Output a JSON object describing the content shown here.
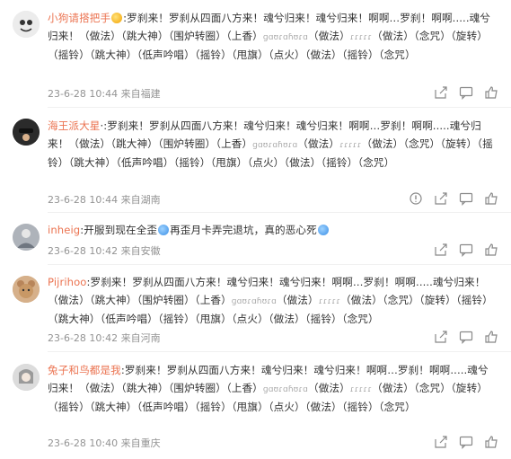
{
  "comments": [
    {
      "username": "小狗请搭把手",
      "text_prefix": ":罗刹来！罗刹从四面八方来！魂兮归来！魂兮归来！啊啊…罗刹！啊啊.....魂兮归来！（做法）（跳大神）（围炉转圈）（上香）",
      "garbled1": "ɡɑʊɾɑɦʊɾɑ",
      "text_mid": "（做法）",
      "garbled2": "ɾɾɾɾɾ",
      "text_suffix": "（做法）（念咒）（旋转）（摇铃）（跳大神）（低声吟唱）（摇铃）（甩旗）（点火）（做法）（摇铃）（念咒）",
      "time": "23-6-28 10:44",
      "location": "来自福建",
      "avatar_color": "#6b6b6b",
      "emoji_after_name": "yellow"
    },
    {
      "username": "海王派大星",
      "text_prefix": "·:罗刹来！罗刹从四面八方来！魂兮归来！魂兮归来！啊啊…罗刹！啊啊.....魂兮归来！（做法）（跳大神）（围炉转圈）（上香）",
      "garbled1": "ɡɑʊɾɑɦʊɾɑ",
      "text_mid": "（做法）",
      "garbled2": "ɾɾɾɾɾ",
      "text_suffix": "（做法）（念咒）（旋转）（摇铃）（跳大神）（低声吟唱）（摇铃）（甩旗）（点火）（做法）（摇铃）（念咒）",
      "time": "23-6-28 10:44",
      "location": "来自湖南",
      "avatar_color": "#2c2c2c",
      "emoji_after_name": ""
    },
    {
      "username": "inheig",
      "text_prefix": ":开服到现在全歪",
      "garbled1": "",
      "text_mid": "再歪月卡弄完退坑，真的恶心死",
      "garbled2": "",
      "text_suffix": "",
      "time": "23-6-28 10:42",
      "location": "来自安徽",
      "avatar_color": "#8a8f96",
      "emoji_after_name": ""
    },
    {
      "username": "Pijrihoo",
      "text_prefix": ":罗刹来！罗刹从四面八方来！魂兮归来！魂兮归来！啊啊…罗刹！啊啊.....魂兮归来！（做法）（跳大神）（围炉转圈）（上香）",
      "garbled1": "ɡɑʊɾɑɦʊɾɑ",
      "text_mid": "（做法）",
      "garbled2": "ɾɾɾɾɾ",
      "text_suffix": "（做法）（念咒）（旋转）（摇铃）（跳大神）（低声吟唱）（摇铃）（甩旗）（点火）（做法）（摇铃）（念咒）",
      "time": "23-6-28 10:42",
      "location": "来自河南",
      "avatar_color": "#c69c6d",
      "emoji_after_name": ""
    },
    {
      "username": "兔子和鸟都是我",
      "text_prefix": ":罗刹来！罗刹从四面八方来！魂兮归来！魂兮归来！啊啊…罗刹！啊啊.....魂兮归来！（做法）（跳大神）（围炉转圈）（上香）",
      "garbled1": "ɡɑʊɾɑɦʊɾɑ",
      "text_mid": "（做法）",
      "garbled2": "ɾɾɾɾɾ",
      "text_suffix": "（做法）（念咒）（旋转）（摇铃）（跳大神）（低声吟唱）（摇铃）（甩旗）（点火）（做法）（摇铃）（念咒）",
      "time": "23-6-28 10:40",
      "location": "来自重庆",
      "avatar_color": "#cfcfcf",
      "emoji_after_name": ""
    }
  ],
  "colors": {
    "username": "#eb7350",
    "meta": "#939393"
  },
  "icons": {
    "share": "share-icon",
    "comment": "comment-icon",
    "like": "thumbs-up-icon",
    "report": "report-icon"
  }
}
